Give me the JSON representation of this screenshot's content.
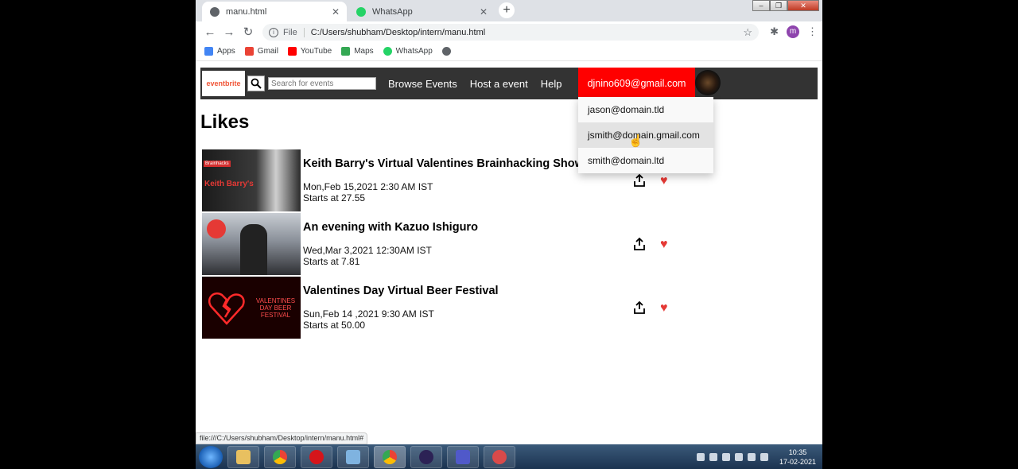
{
  "browser": {
    "tabs": [
      {
        "title": "manu.html",
        "close": "✕"
      },
      {
        "title": "WhatsApp",
        "close": "✕"
      }
    ],
    "new_tab": "+",
    "omnibox": {
      "scheme": "File",
      "url": "C:/Users/shubham/Desktop/intern/manu.html"
    },
    "profile_initial": "m",
    "bookmarks": [
      {
        "label": "Apps",
        "color": "#4285f4"
      },
      {
        "label": "Gmail",
        "color": "#ea4335"
      },
      {
        "label": "YouTube",
        "color": "#ff0000"
      },
      {
        "label": "Maps",
        "color": "#34a853"
      },
      {
        "label": "WhatsApp",
        "color": "#25d366"
      },
      {
        "label": "",
        "color": "#5f6368"
      }
    ],
    "status_url": "file:///C:/Users/shubham/Desktop/intern/manu.html#"
  },
  "header": {
    "logo": "eventbrite",
    "search_placeholder": "Search for events",
    "nav": [
      "Browse Events",
      "Host a event",
      "Help"
    ],
    "user_email": "djnino609@gmail.com"
  },
  "dropdown": [
    "jason@domain.tld",
    "jsmith@domain.gmail.com",
    "smith@domain.ltd"
  ],
  "page": {
    "title": "Likes",
    "events": [
      {
        "title": "Keith Barry's Virtual Valentines Brainhacking Show",
        "date": "Mon,Feb 15,2021 2:30 AM IST",
        "start": "Starts at 27.55",
        "thumb_text": "Keith Barry's"
      },
      {
        "title": "An evening with Kazuo Ishiguro",
        "date": "Wed,Mar 3,2021 12:30AM IST",
        "start": "Starts at 7.81",
        "thumb_text": ""
      },
      {
        "title": "Valentines Day Virtual Beer Festival",
        "date": "Sun,Feb 14 ,2021 9:30 AM IST",
        "start": "Starts at 50.00",
        "thumb_text": "VALENTINES DAY BEER FESTIVAL"
      }
    ]
  },
  "taskbar": {
    "time": "10:35",
    "date": "17-02-2021"
  },
  "colors": {
    "header_bg": "#333333",
    "user_button": "#ff0000",
    "heart": "#e53935",
    "logo": "#f05537"
  }
}
